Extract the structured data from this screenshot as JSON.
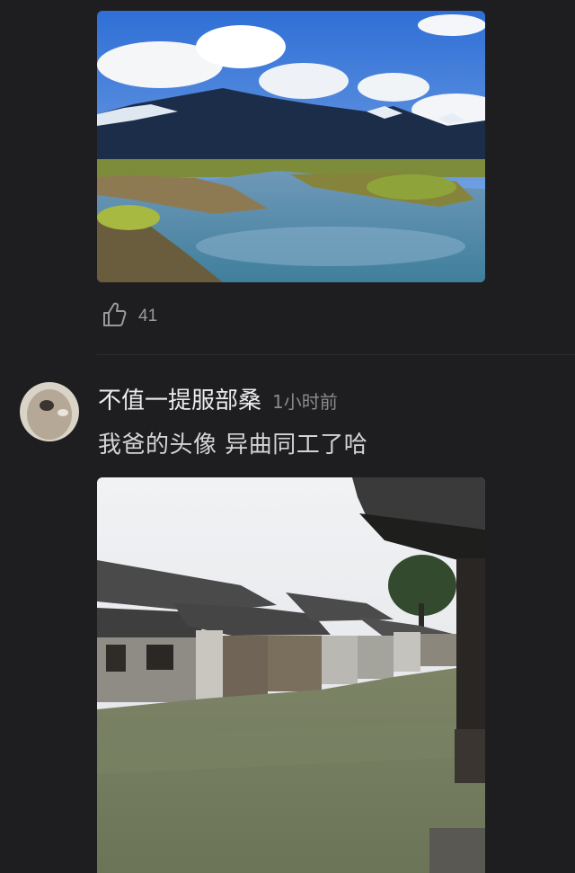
{
  "post": {
    "image_top": {
      "subject": "mountain-river-landscape"
    },
    "like_count": "41"
  },
  "comment": {
    "author": "不值一提服部桑",
    "time": "1小时前",
    "text": "我爸的头像 异曲同工了哈",
    "image": {
      "subject": "water-town-canal"
    }
  },
  "colors": {
    "background": "#1e1e20",
    "muted_text": "#9a9a9e",
    "primary_text": "#ececec"
  },
  "icons": {
    "like": "thumbs-up-icon"
  }
}
